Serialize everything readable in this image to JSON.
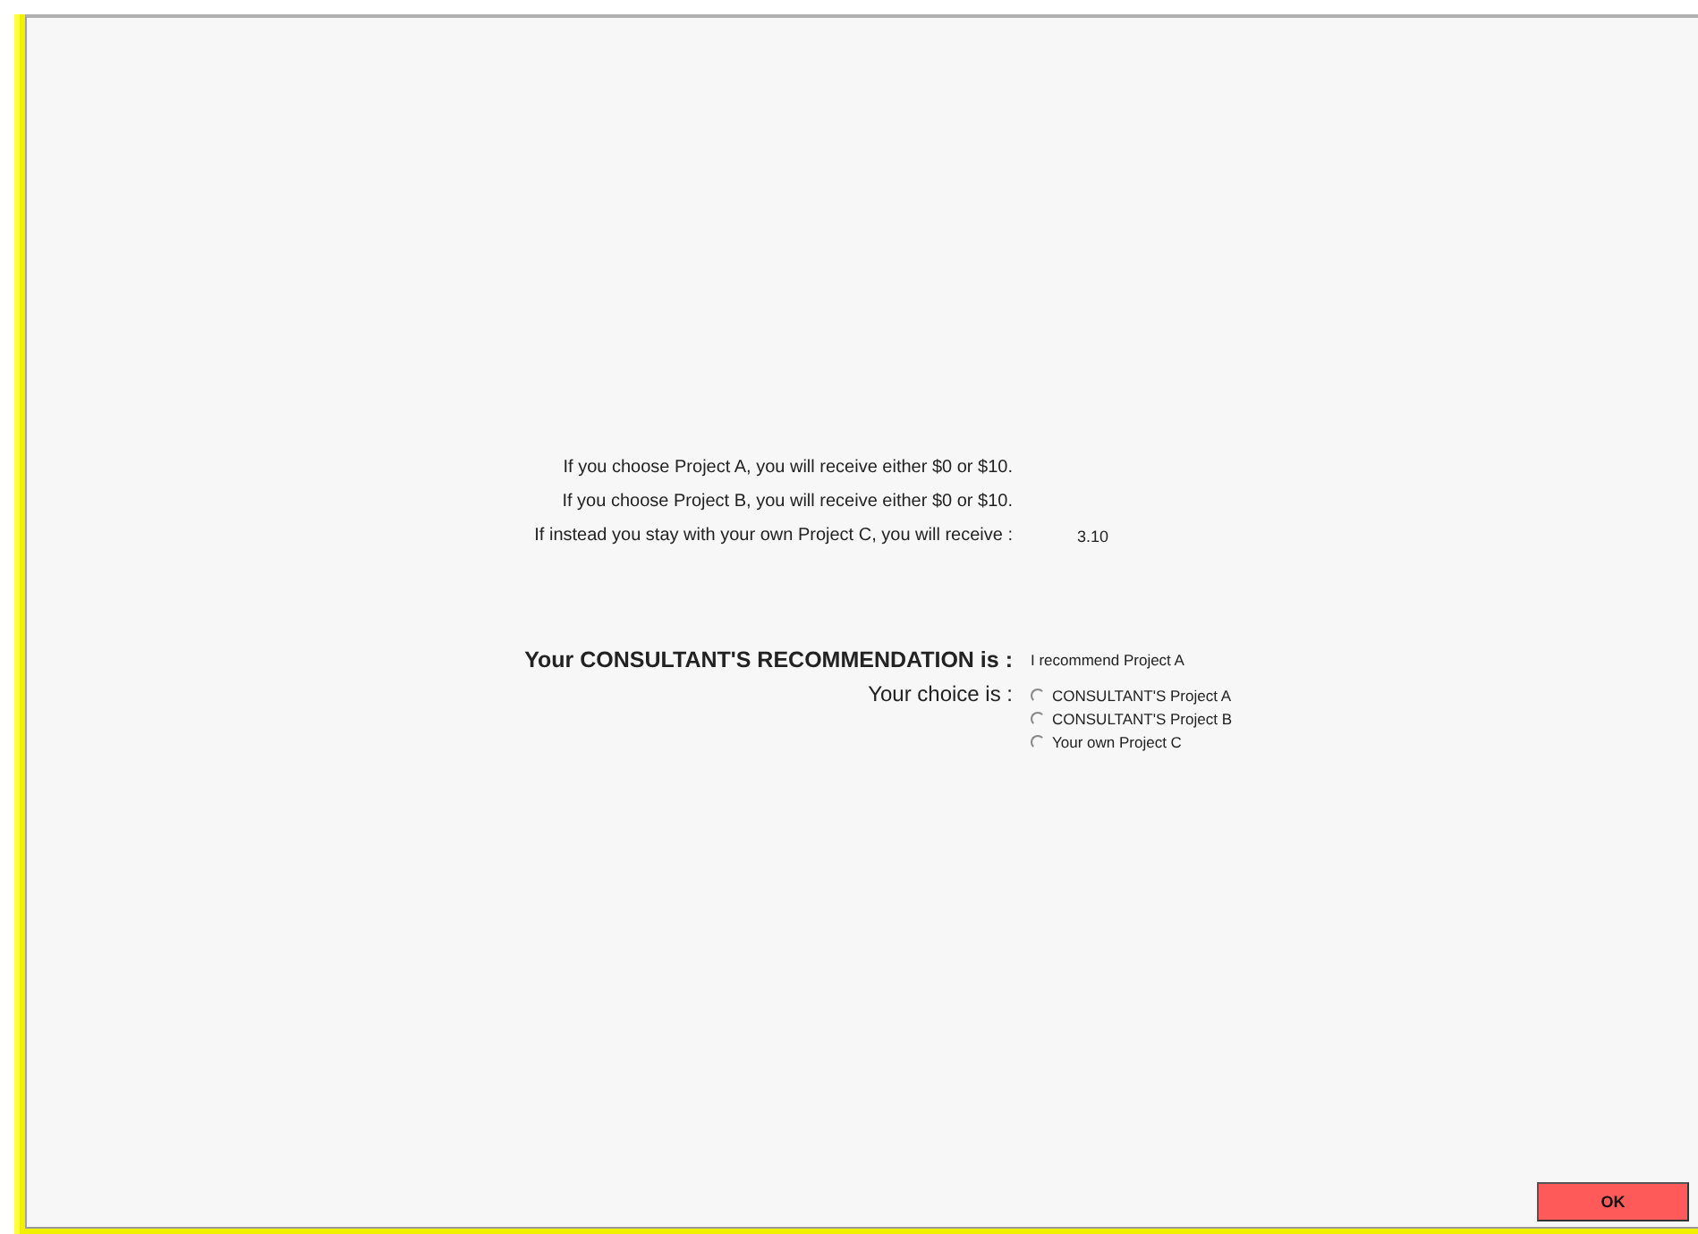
{
  "info_lines": [
    {
      "label": "If you choose Project A, you will receive either $0 or $10."
    },
    {
      "label": "If you choose Project B, you will receive either $0 or $10."
    },
    {
      "label": "If instead you stay with your own Project C, you will receive :",
      "value": "3.10"
    }
  ],
  "recommendation": {
    "label": "Your CONSULTANT'S RECOMMENDATION is :",
    "value": "I recommend Project A"
  },
  "choice": {
    "label": "Your choice is :",
    "options": [
      {
        "label": "CONSULTANT'S Project A",
        "selected": false
      },
      {
        "label": "CONSULTANT'S Project B",
        "selected": false
      },
      {
        "label": "Your own Project C",
        "selected": false
      }
    ]
  },
  "ok_button": "OK"
}
